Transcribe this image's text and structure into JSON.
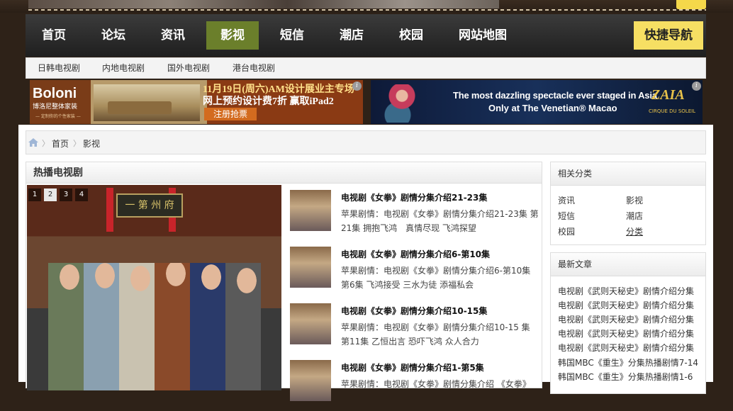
{
  "nav": {
    "items": [
      "首页",
      "论坛",
      "资讯",
      "影视",
      "短信",
      "潮店",
      "校园",
      "网站地图"
    ],
    "active": "影视",
    "quick": "快捷导航"
  },
  "subnav": [
    "日韩电视剧",
    "内地电视剧",
    "国外电视剧",
    "港台电视剧"
  ],
  "ads": {
    "boloni": {
      "brand": "Boloni",
      "brand_sub": "博洛尼整体家装",
      "brand_tag": "— 定制你的个性家装 —",
      "line1": "11月19日(周六)AM设计展业主专场",
      "line2": "网上预约设计费7折 赢取iPad2",
      "cta": "注册抢票"
    },
    "zaia": {
      "line1": "The most dazzling spectacle ever staged in Asia",
      "line2": "Only at The Venetian® Macao",
      "logo": "ZAIA",
      "logo_sub": "CIRQUE DU SOLEIL"
    },
    "info_glyph": "i"
  },
  "breadcrumb": {
    "home": "首页",
    "current": "影视",
    "sep": "〉"
  },
  "hot_tv": {
    "title": "热播电视剧",
    "slide_sign": "一 第 州 府",
    "pager": [
      "1",
      "2",
      "3",
      "4"
    ],
    "active_page": "2",
    "articles": [
      {
        "title": "电视剧《女拳》剧情分集介绍21-23集",
        "desc": "苹果剧情：电视剧《女拳》剧情分集介绍21-23集 第21集 拥抱飞鸿　真情尽现 飞鸿探望"
      },
      {
        "title": "电视剧《女拳》剧情分集介绍6-第10集",
        "desc": "苹果剧情：电视剧《女拳》剧情分集介绍6-第10集 第6集 飞鸿接受 三水为徒 添福私会"
      },
      {
        "title": "电视剧《女拳》剧情分集介绍10-15集",
        "desc": "苹果剧情：电视剧《女拳》剧情分集介绍10-15 集 第11集 乙恒出言 恐吓飞鸿 众人合力"
      },
      {
        "title": "电视剧《女拳》剧情分集介绍1-第5集",
        "desc": "苹果剧情：电视剧《女拳》剧情分集介绍 《女拳》"
      }
    ]
  },
  "related": {
    "title": "相关分类",
    "items": [
      "资讯",
      "影视",
      "短信",
      "潮店",
      "校园",
      "分类"
    ]
  },
  "latest": {
    "title": "最新文章",
    "items": [
      "电视剧《武则天秘史》剧情介绍分集",
      "电视剧《武则天秘史》剧情介绍分集",
      "电视剧《武则天秘史》剧情介绍分集",
      "电视剧《武则天秘史》剧情介绍分集",
      "电视剧《武则天秘史》剧情介绍分集",
      "韩国MBC《重生》分集热播剧情7-14",
      "韩国MBC《重生》分集热播剧情1-6"
    ]
  },
  "colors": {
    "nav_active": "#6b7f2b",
    "quick_nav": "#f6df63",
    "page_bg": "#2e2218"
  }
}
